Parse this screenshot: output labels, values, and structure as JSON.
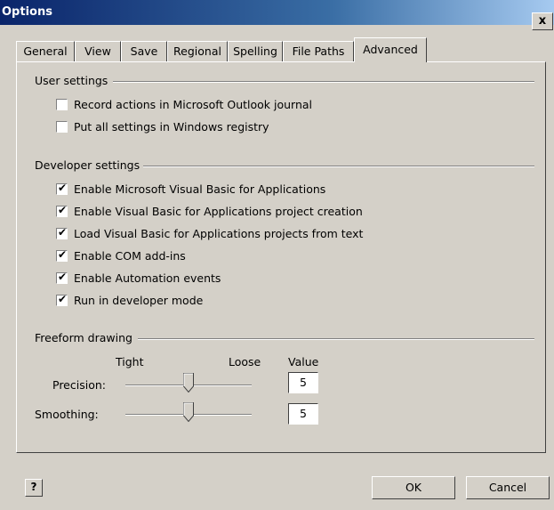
{
  "window": {
    "title": "Options",
    "close_glyph": "x"
  },
  "tabs": [
    "General",
    "View",
    "Save",
    "Regional",
    "Spelling",
    "File Paths",
    "Advanced"
  ],
  "active_tab": "Advanced",
  "user_settings": {
    "heading": "User settings",
    "items": [
      {
        "label": "Record actions in Microsoft Outlook journal",
        "checked": false
      },
      {
        "label": "Put all settings in Windows registry",
        "checked": false
      }
    ]
  },
  "developer_settings": {
    "heading": "Developer settings",
    "items": [
      {
        "label": "Enable Microsoft Visual Basic for Applications",
        "checked": true
      },
      {
        "label": "Enable Visual Basic for Applications project creation",
        "checked": true
      },
      {
        "label": "Load Visual Basic for Applications projects from text",
        "checked": true
      },
      {
        "label": "Enable COM add-ins",
        "checked": true
      },
      {
        "label": "Enable Automation events",
        "checked": true
      },
      {
        "label": "Run in developer mode",
        "checked": true
      }
    ]
  },
  "freeform_drawing": {
    "heading": "Freeform drawing",
    "tight_label": "Tight",
    "loose_label": "Loose",
    "value_label": "Value",
    "precision": {
      "label": "Precision:",
      "value": "5"
    },
    "smoothing": {
      "label": "Smoothing:",
      "value": "5"
    }
  },
  "buttons": {
    "ok": "OK",
    "cancel": "Cancel",
    "help_glyph": "?"
  },
  "colors": {
    "face": "#d4d0c8",
    "title_start": "#0a246a",
    "title_end": "#a6caf0"
  }
}
